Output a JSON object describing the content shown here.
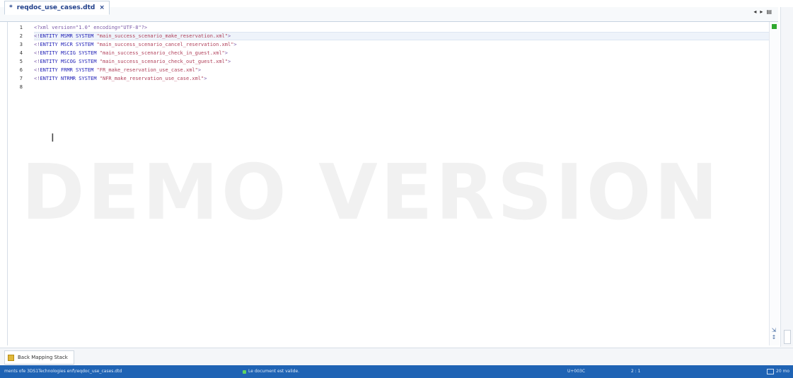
{
  "editor_tab": {
    "title": "reqdoc_use_cases.dtd",
    "modified_marker": "*",
    "close_glyph": "×"
  },
  "tab_nav": {
    "prev": "◂",
    "next": "▸",
    "menu": "▤"
  },
  "gutter": {
    "lines": [
      "1",
      "2",
      "3",
      "4",
      "5",
      "6",
      "7",
      "8"
    ]
  },
  "code": {
    "line1": {
      "decl": "<?xml version=\"1.0\" encoding=\"UTF-8\"?>"
    },
    "entities": [
      {
        "open": "<!",
        "kw": "ENTITY",
        "name": "MSMR",
        "system": "SYSTEM",
        "value": "\"main_success_scenario_make_reservation.xml\"",
        "close": ">"
      },
      {
        "open": "<!",
        "kw": "ENTITY",
        "name": "MSCR",
        "system": "SYSTEM",
        "value": "\"main_success_scenario_cancel_reservation.xml\"",
        "close": ">"
      },
      {
        "open": "<!",
        "kw": "ENTITY",
        "name": "MSCIG",
        "system": "SYSTEM",
        "value": "\"main_success_scenario_check_in_guest.xml\"",
        "close": ">"
      },
      {
        "open": "<!",
        "kw": "ENTITY",
        "name": "MSCOG",
        "system": "SYSTEM",
        "value": "\"main_success_scenario_check_out_guest.xml\"",
        "close": ">"
      },
      {
        "open": "<!",
        "kw": "ENTITY",
        "name": "FRMR",
        "system": "SYSTEM",
        "value": "\"FR_make_reservation_use_case.xml\"",
        "close": ">"
      },
      {
        "open": "<!",
        "kw": "ENTITY",
        "name": "NTRMR",
        "system": "SYSTEM",
        "value": "\"NFR_make_reservation_use_case.xml\"",
        "close": ">"
      }
    ]
  },
  "watermark": "DEMO VERSION",
  "cursor_glyph": "I",
  "bottom_view": {
    "tab_label": "Back Mapping Stack"
  },
  "status": {
    "path": "ments ofe 3DS1Technologies enf\\reqdoc_use_cases.dtd",
    "validation": "Le document est valide.",
    "encoding": "U+003C",
    "position": "2 : 1",
    "right": "20 mo"
  },
  "colors": {
    "statusbar_bg": "#1f63b4",
    "keyword": "#1b1bb5",
    "string": "#b0405a",
    "processing_instruction": "#7a5aa8",
    "valid_marker": "#2fa82f"
  }
}
